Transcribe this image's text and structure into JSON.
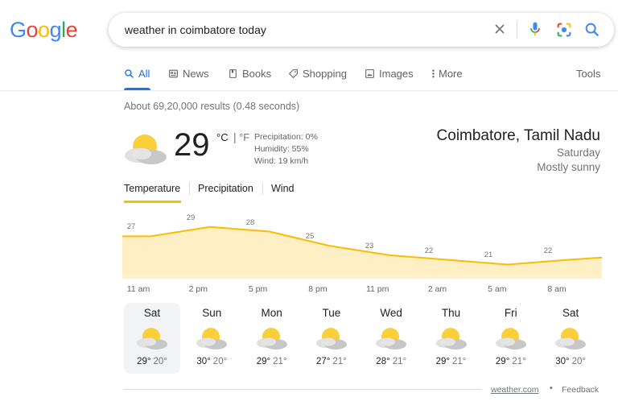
{
  "logo": {
    "letters": [
      "G",
      "o",
      "o",
      "g",
      "l",
      "e"
    ],
    "colors": [
      "#4285f4",
      "#ea4335",
      "#fbbc05",
      "#4285f4",
      "#34a853",
      "#ea4335"
    ]
  },
  "search": {
    "query": "weather in coimbatore today"
  },
  "icons": {
    "clear": "close-icon",
    "mic": "mic-icon",
    "lens": "camera-lens-icon",
    "search": "search-icon"
  },
  "tabs": [
    {
      "label": "All",
      "icon": "search-icon",
      "active": true
    },
    {
      "label": "News",
      "icon": "newspaper-icon"
    },
    {
      "label": "Books",
      "icon": "book-icon"
    },
    {
      "label": "Shopping",
      "icon": "tag-icon"
    },
    {
      "label": "Images",
      "icon": "image-icon"
    },
    {
      "label": "More",
      "icon": "kebab-icon"
    }
  ],
  "tools": "Tools",
  "result_stats": "About 69,20,000 results (0.48 seconds)",
  "weather": {
    "temp": "29",
    "unit_c": "°C",
    "unit_sep": "|",
    "unit_f": "°F",
    "precipitation": "Precipitation: 0%",
    "humidity": "Humidity: 55%",
    "wind": "Wind: 19 km/h",
    "location": "Coimbatore, Tamil Nadu",
    "day": "Saturday",
    "condition": "Mostly sunny",
    "subtabs": [
      "Temperature",
      "Precipitation",
      "Wind"
    ]
  },
  "chart_data": {
    "type": "area",
    "x": [
      "11 am",
      "2 pm",
      "5 pm",
      "8 pm",
      "11 pm",
      "2 am",
      "5 am",
      "8 am"
    ],
    "values": [
      27,
      29,
      28,
      25,
      23,
      22,
      21,
      22
    ],
    "xlabel": "",
    "ylabel": "",
    "color": "#fbbc04",
    "fill": "#fef0c4"
  },
  "forecast": [
    {
      "day": "Sat",
      "hi": "29°",
      "lo": "20°"
    },
    {
      "day": "Sun",
      "hi": "30°",
      "lo": "20°"
    },
    {
      "day": "Mon",
      "hi": "29°",
      "lo": "21°"
    },
    {
      "day": "Tue",
      "hi": "27°",
      "lo": "21°"
    },
    {
      "day": "Wed",
      "hi": "28°",
      "lo": "21°"
    },
    {
      "day": "Thu",
      "hi": "29°",
      "lo": "21°"
    },
    {
      "day": "Fri",
      "hi": "29°",
      "lo": "21°"
    },
    {
      "day": "Sat",
      "hi": "30°",
      "lo": "20°"
    }
  ],
  "footer": {
    "source": "weather.com",
    "separator": "•",
    "feedback": "Feedback"
  }
}
